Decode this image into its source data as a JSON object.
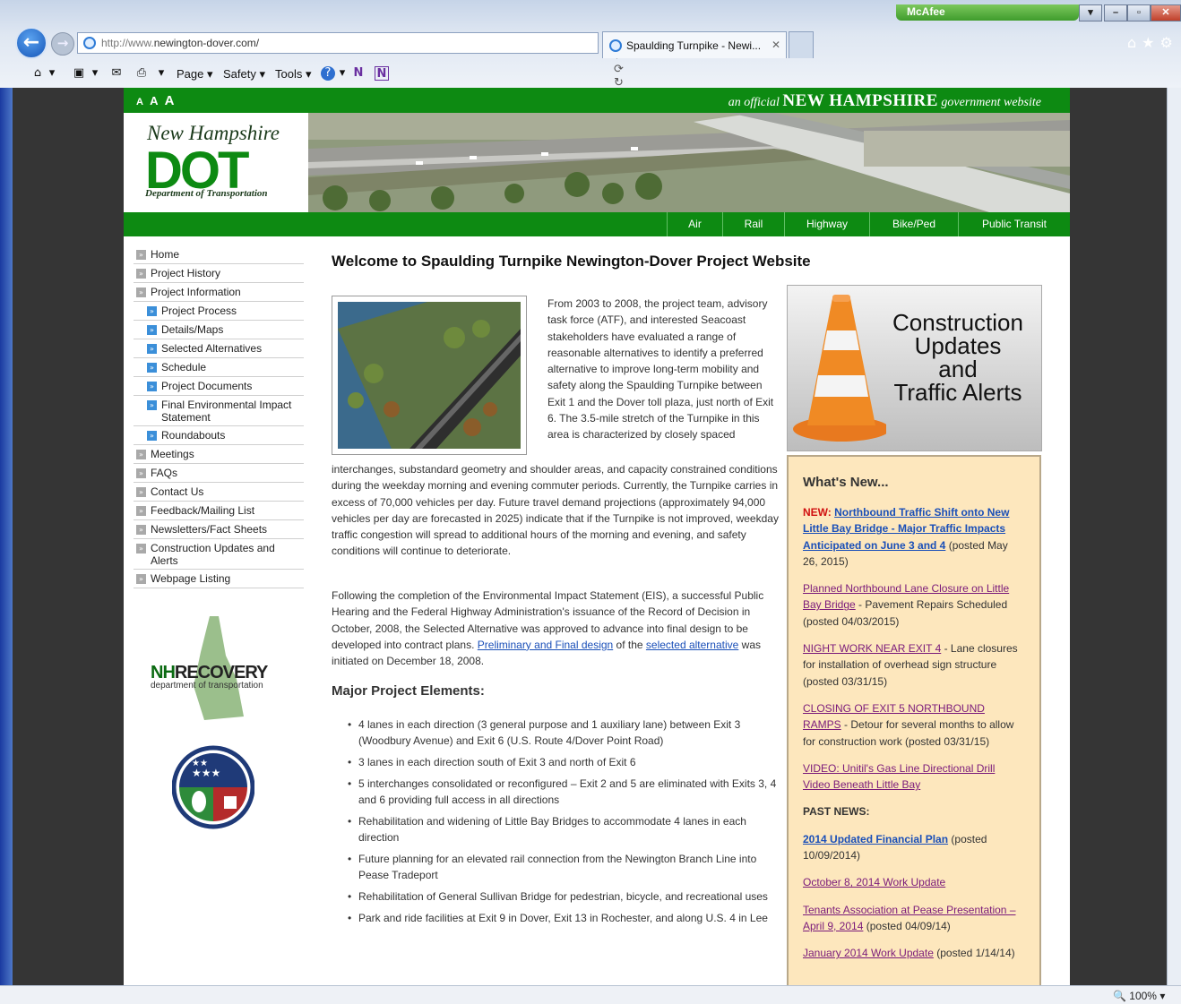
{
  "browser": {
    "mcafee_label": "McAfee",
    "address": {
      "protocol": "http://www.",
      "domain": "newington-dover.com/"
    },
    "tab_title": "Spaulding Turnpike - Newi...",
    "zoom": "100%",
    "menu": {
      "page": "Page",
      "safety": "Safety",
      "tools": "Tools"
    }
  },
  "header": {
    "text_size": {
      "small": "A",
      "medium": "A",
      "large": "A"
    },
    "official_prefix": "an official",
    "official_state": "NEW HAMPSHIRE",
    "official_suffix": "government website",
    "logo_script": "New Hampshire",
    "logo_letters": "DOT",
    "logo_dept": "Department of Transportation"
  },
  "nav": {
    "items": [
      "Air",
      "Rail",
      "Highway",
      "Bike/Ped",
      "Public Transit"
    ]
  },
  "sidebar": {
    "items": [
      {
        "label": "Home",
        "sub": false
      },
      {
        "label": "Project History",
        "sub": false
      },
      {
        "label": "Project Information",
        "sub": false
      },
      {
        "label": "Project Process",
        "sub": true
      },
      {
        "label": "Details/Maps",
        "sub": true
      },
      {
        "label": "Selected Alternatives",
        "sub": true
      },
      {
        "label": "Schedule",
        "sub": true
      },
      {
        "label": "Project Documents",
        "sub": true
      },
      {
        "label": "Final Environmental Impact Statement",
        "sub": true
      },
      {
        "label": "Roundabouts",
        "sub": true
      },
      {
        "label": "Meetings",
        "sub": false
      },
      {
        "label": "FAQs",
        "sub": false
      },
      {
        "label": "Contact Us",
        "sub": false
      },
      {
        "label": "Feedback/Mailing List",
        "sub": false
      },
      {
        "label": "Newsletters/Fact Sheets",
        "sub": false
      },
      {
        "label": "Construction Updates and Alerts",
        "sub": false
      },
      {
        "label": "Webpage Listing",
        "sub": false
      }
    ],
    "nh_recovery": {
      "nh": "NH",
      "word": "RECOVERY",
      "sub": "department of transportation"
    }
  },
  "main": {
    "welcome": "Welcome to Spaulding Turnpike Newington-Dover Project Website",
    "intro_side": "From 2003 to 2008, the project team, advisory task force (ATF), and interested Seacoast stakeholders have evaluated a range of reasonable alternatives to identify a preferred alternative to improve long-term mobility and safety along the Spaulding Turnpike between Exit 1 and the Dover toll plaza, just north of Exit 6. The 3.5-mile stretch of the Turnpike in this area is characterized by closely spaced",
    "intro_full": "interchanges, substandard geometry and shoulder areas, and capacity constrained conditions during the weekday morning and evening commuter periods. Currently, the Turnpike carries in excess of 70,000 vehicles per day. Future travel demand projections (approximately 94,000 vehicles per day are forecasted in 2025) indicate that if the Turnpike is not improved, weekday traffic congestion will spread to additional hours of the morning and evening, and safety conditions will continue to deteriorate.",
    "para2_a": "Following the completion of the Environmental Impact Statement (EIS), a successful Public Hearing and the Federal Highway Administration's issuance of the Record of Decision in October, 2008, the Selected Alternative was approved to advance into final design to be developed into contract plans.",
    "para2_link1": "Preliminary and Final design",
    "para2_b": "of the",
    "para2_link2": "selected alternative",
    "para2_c": "was initiated on December 18, 2008.",
    "major_heading": "Major Project Elements:",
    "elements": [
      "4 lanes in each direction (3 general purpose and 1 auxiliary lane) between Exit 3 (Woodbury Avenue) and Exit 6 (U.S. Route 4/Dover Point Road)",
      "3 lanes in each direction south of Exit 3 and north of Exit 6",
      "5 interchanges consolidated or reconfigured – Exit 2 and 5 are eliminated with Exits 3, 4 and 6 providing full access in all directions",
      "Rehabilitation and widening of Little Bay Bridges to accommodate 4 lanes in each direction",
      "Future planning for an elevated rail connection from the Newington Branch Line into Pease Tradeport",
      "Rehabilitation of General Sullivan Bridge for pedestrian, bicycle, and recreational uses",
      "Park and ride facilities at Exit 9 in Dover, Exit 13 in Rochester, and along U.S. 4 in Lee"
    ]
  },
  "right": {
    "cone_text": [
      "Construction",
      "Updates",
      "and",
      "Traffic Alerts"
    ],
    "whats_new": "What's New...",
    "new_tag": "NEW:",
    "news1_link": "Northbound Traffic Shift onto New Little Bay Bridge - Major Traffic Impacts Anticipated on June 3 and 4",
    "news1_posted": "(posted May 26, 2015)",
    "news2_link": "Planned Northbound Lane Closure on Little Bay Bridge",
    "news2_text": "- Pavement Repairs Scheduled (posted 04/03/2015)",
    "news3_link": "NIGHT WORK NEAR EXIT 4",
    "news3_text": "- Lane closures for installation of overhead sign structure (posted 03/31/15)",
    "news4_link": "CLOSING OF EXIT 5 NORTHBOUND RAMPS",
    "news4_text": "- Detour for several months to allow for construction work (posted 03/31/15)",
    "news5_link": "VIDEO: Unitil's Gas Line Directional Drill Video Beneath Little Bay",
    "past_news": "PAST NEWS:",
    "past1_link": "2014 Updated Financial Plan",
    "past1_text": "(posted 10/09/2014)",
    "past2_link": "October 8, 2014 Work Update",
    "past3_link": "Tenants Association at Pease Presentation – April 9, 2014",
    "past3_text": "(posted 04/09/14)",
    "past4_link": "January 2014 Work Update",
    "past4_text": "(posted 1/14/14)"
  }
}
